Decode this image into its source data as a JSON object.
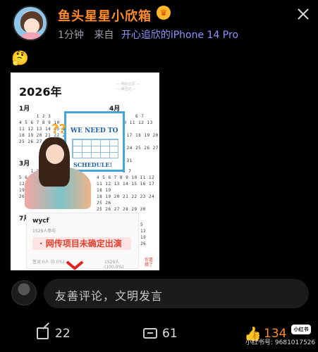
{
  "post": {
    "username": "鱼头星星小欣箱",
    "time": "1分钟",
    "from_label": "来自",
    "device": "开心追欣的iPhone 14 Pro",
    "emoji": "🤔"
  },
  "image": {
    "year": "2026年",
    "watermark": "— 明年日历 —\n— 美回记 —",
    "months": [
      "1月",
      "3月",
      "4月",
      "7月"
    ],
    "sticker_top": "WE NEED TO",
    "sticker_bottom": "SCHEDULE!",
    "poll_author": "wycf",
    "poll_count": "1529人参与",
    "poll_option": "网传项目未确定出演",
    "poll_footer_left": "签对 0人 (0.0%)",
    "poll_footer_right": "1529人 (100.0%)",
    "pick_label": "你喜\n猜了"
  },
  "comment": {
    "placeholder": "友善评论，文明发言"
  },
  "actions": {
    "reposts": "22",
    "comments": "61",
    "likes": "134"
  },
  "overlay": {
    "badge": "小红书",
    "id_text": "小红书号: 9681017526"
  },
  "colors": {
    "username": "#ff8a2a",
    "device_link": "#8c94ff",
    "poll_red": "#e2422f"
  }
}
